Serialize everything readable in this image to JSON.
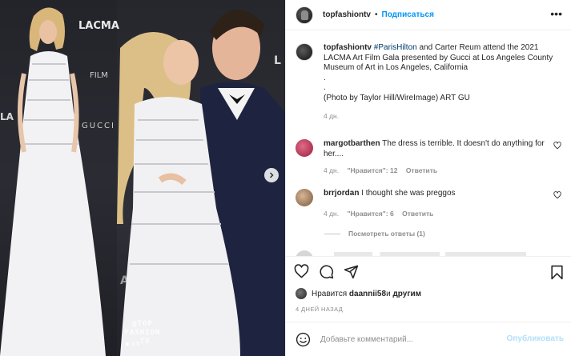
{
  "post": {
    "username": "topfashiontv",
    "separator": "•",
    "follow_label": "Подписаться",
    "more_label": "•••"
  },
  "photo": {
    "watermark_line1": "@TOP",
    "watermark_line2": "FASHION",
    "watermark_line3": ".TV",
    "backdrop_text_1": "LACMA",
    "backdrop_text_2": "FILM",
    "backdrop_text_3": "GUCCI",
    "backdrop_text_4": "LA",
    "backdrop_text_5": "ART",
    "current_slide": 1,
    "total_slides": 3
  },
  "caption": {
    "username": "topfashiontv",
    "hashtag": "#ParisHilton",
    "text": " and Carter Reum attend the 2021 LACMA Art Film Gala presented by Gucci at Los Angeles County Museum of Art in Los Angeles, California",
    "dot1": ".",
    "dot2": ".",
    "credit": "(Photo by Taylor Hill/WireImage) ART GU",
    "time": "4 дн."
  },
  "comments": [
    {
      "username": "margotbarthen",
      "text": "The dress is terrible. It doesn't do anything for her....",
      "time": "4 дн.",
      "likes": "\"Нравится\": 12",
      "reply": "Ответить",
      "avatar_color": "#c23a5c"
    },
    {
      "username": "brrjordan",
      "text": "I thought she was preggos",
      "time": "4 дн.",
      "likes": "\"Нравится\": 6",
      "reply": "Ответить",
      "avatar_color": "#b08a6a"
    }
  ],
  "view_replies": "Посмотреть ответы (1)",
  "likes": {
    "prefix": "Нравится ",
    "user": "daannii58",
    "suffix": " и ",
    "others": "другим"
  },
  "post_date": "4 ДНЕЙ НАЗАД",
  "add_comment": {
    "placeholder": "Добавьте комментарий...",
    "publish_label": "Опубликовать"
  },
  "colors": {
    "accent": "#0095f6",
    "hashtag": "#00376b",
    "muted": "#8e8e8e",
    "publish_disabled": "#b2dffc"
  }
}
